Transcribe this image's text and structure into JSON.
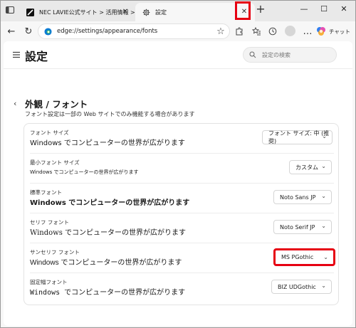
{
  "tabs": [
    {
      "title": "NEC LAVIE公式サイト > 活用情報 >",
      "active": false
    },
    {
      "title": "設定",
      "active": true
    }
  ],
  "toolbar": {
    "url": "edge://settings/appearance/fonts",
    "chat_label": "チャット"
  },
  "window_controls": {
    "minimize": "—",
    "maximize": "☐",
    "close": "✕"
  },
  "settings": {
    "header_title": "設定",
    "search_placeholder": "設定の検索",
    "section_title": "外観 / フォント",
    "section_desc": "フォント設定は一部の Web サイトでのみ機能する場合があります"
  },
  "font_rows": [
    {
      "label": "フォント サイズ",
      "sample": "Windows でコンピューターの世界が広がります",
      "value": "フォント サイズ: 中 (推奨)"
    },
    {
      "label": "最小フォント サイズ",
      "sample": "Windows でコンピューターの世界が広がります",
      "value": "カスタム"
    },
    {
      "label": "標準フォント",
      "sample": "Windows でコンピューターの世界が広がります",
      "value": "Noto Sans JP"
    },
    {
      "label": "セリフ フォント",
      "sample": "Windows でコンピューターの世界が広がります",
      "value": "Noto Serif JP"
    },
    {
      "label": "サンセリフ フォント",
      "sample": "Windows でコンピューターの世界が広がります",
      "value": "MS PGothic"
    },
    {
      "label": "固定幅フォント",
      "sample": "Windows でコンピューターの世界が広がります",
      "value": "BIZ UDGothic"
    }
  ],
  "icons": {
    "close": "✕",
    "plus": "+",
    "back": "←",
    "refresh": "↻",
    "star": "☆",
    "chevron_left": "‹",
    "chevron_down": "⌄",
    "more": "…"
  },
  "highlight_color": "#e60012"
}
